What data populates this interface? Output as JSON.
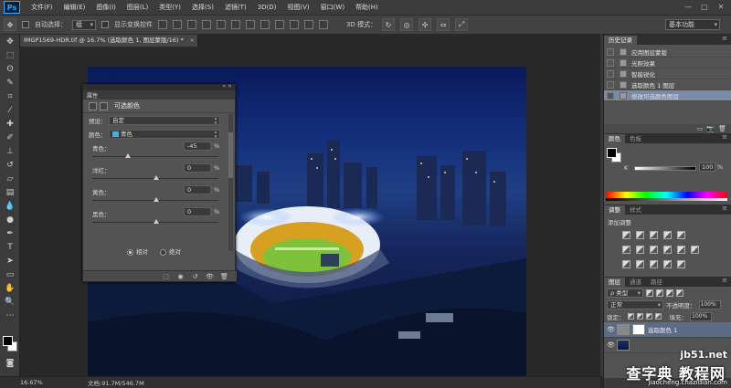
{
  "app": {
    "logo": "Ps"
  },
  "menubar": {
    "items": [
      "文件(F)",
      "编辑(E)",
      "图像(I)",
      "图层(L)",
      "类型(Y)",
      "选择(S)",
      "滤镜(T)",
      "3D(D)",
      "视图(V)",
      "窗口(W)",
      "帮助(H)"
    ]
  },
  "options": {
    "auto_select_label": "自动选择：",
    "auto_select_value": "组",
    "show_transform_label": "显示变换控件",
    "mode3d_label": "3D 模式：",
    "workspace": "基本功能"
  },
  "document": {
    "tab_title": "IMGP1569-HDR.tif @ 16.7% (选取颜色 1, 图层蒙版/16) *",
    "zoom": "16.67%",
    "doc_info": "文档:91.7M/546.7M"
  },
  "properties": {
    "tab": "属性",
    "title": "可选颜色",
    "preset_label": "预设：",
    "preset_value": "自定",
    "colors_label": "颜色：",
    "colors_value": "青色",
    "sliders": [
      {
        "label": "青色：",
        "value": "-45",
        "unit": "%",
        "level": -45
      },
      {
        "label": "洋红：",
        "value": "0",
        "unit": "%",
        "level": 0
      },
      {
        "label": "黄色：",
        "value": "0",
        "unit": "%",
        "level": 0
      },
      {
        "label": "黑色：",
        "value": "0",
        "unit": "%",
        "level": 0
      }
    ],
    "method_relative": "相对",
    "method_absolute": "绝对"
  },
  "history": {
    "tabs": [
      "历史记录"
    ],
    "items": [
      "应用图层蒙版",
      "光照效果",
      "智能锐化",
      "选取颜色 1 图层",
      "修改可选颜色图层"
    ]
  },
  "color_panel": {
    "tabs": [
      "颜色",
      "色板"
    ],
    "k_label": "K",
    "k_value": "100",
    "k_unit": "%"
  },
  "adjustments": {
    "tabs": [
      "调整",
      "样式"
    ],
    "title": "添加调整"
  },
  "layers": {
    "tabs": [
      "图层",
      "通道",
      "路径"
    ],
    "kind": "类型",
    "blend_mode": "正常",
    "opacity_label": "不透明度：",
    "opacity_value": "100%",
    "lock_label": "锁定：",
    "fill_label": "填充：",
    "fill_value": "100%",
    "layer_name": "选取颜色 1"
  },
  "watermark": {
    "domain": "jb51.net",
    "cn": "查字典 教程网",
    "url": "jiaocheng.chazidian.com"
  }
}
